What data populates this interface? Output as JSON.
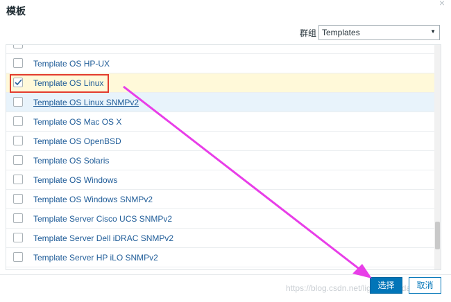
{
  "dialog": {
    "title": "模板",
    "close_glyph": "×"
  },
  "filter": {
    "label": "群组",
    "selected": "Templates"
  },
  "list": {
    "partial_top_label": "Template OS HP-UX",
    "items": [
      {
        "label": "Template OS HP-UX",
        "checked": false
      },
      {
        "label": "Template OS Linux",
        "checked": true
      },
      {
        "label": "Template OS Linux SNMPv2",
        "checked": false
      },
      {
        "label": "Template OS Mac OS X",
        "checked": false
      },
      {
        "label": "Template OS OpenBSD",
        "checked": false
      },
      {
        "label": "Template OS Solaris",
        "checked": false
      },
      {
        "label": "Template OS Windows",
        "checked": false
      },
      {
        "label": "Template OS Windows SNMPv2",
        "checked": false
      },
      {
        "label": "Template Server Cisco UCS SNMPv2",
        "checked": false
      },
      {
        "label": "Template Server Dell iDRAC SNMPv2",
        "checked": false
      },
      {
        "label": "Template Server HP iLO SNMPv2",
        "checked": false
      }
    ]
  },
  "buttons": {
    "select": "选择",
    "cancel": "取消"
  },
  "watermark": "https://blog.csdn.net/liguanweisdahoo",
  "colors": {
    "primary": "#0275b8",
    "annotation_box": "#e33b2e",
    "annotation_arrow": "#e83ee8",
    "link": "#1f5c98"
  }
}
